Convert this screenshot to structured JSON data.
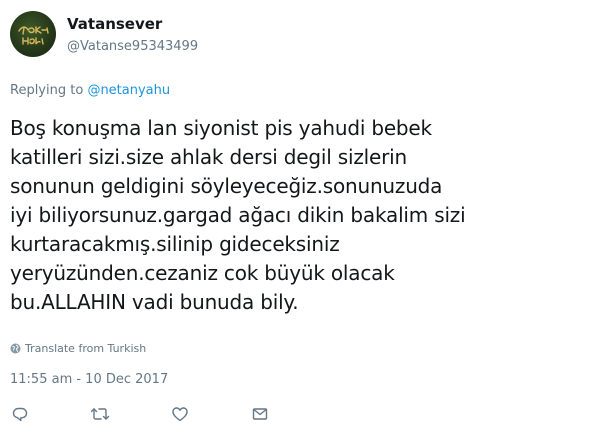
{
  "author": {
    "avatar_icon": "avatar-image",
    "display_name": "Vatansever",
    "handle": "@Vatanse95343499"
  },
  "reply_context": {
    "prefix": "Replying to",
    "mention": "@netanyahu"
  },
  "tweet": {
    "lines": [
      "Boş konuşma lan siyonist pis yahudi bebek",
      "katilleri sizi.size ahlak dersi degil sizlerin",
      "sonunun geldigini söyleyeceğiz.sonunuzuda",
      "iyi biliyorsunuz.gargad ağacı dikin bakalim sizi",
      "kurtaracakmış.silinip gideceksiniz",
      "yeryüzünden.cezaniz cok büyük olacak",
      "bu.ALLAHIN vadi bunuda bily."
    ],
    "translate_label": "Translate from Turkish",
    "timestamp": "11:55 am - 10 Dec 2017"
  },
  "actions": [
    {
      "name": "reply",
      "icon": "reply-icon"
    },
    {
      "name": "retweet",
      "icon": "retweet-icon"
    },
    {
      "name": "like",
      "icon": "heart-icon"
    },
    {
      "name": "direct-message",
      "icon": "envelope-icon"
    }
  ],
  "colors": {
    "text": "#14171a",
    "secondary": "#657786",
    "link": "#1b95e0"
  }
}
